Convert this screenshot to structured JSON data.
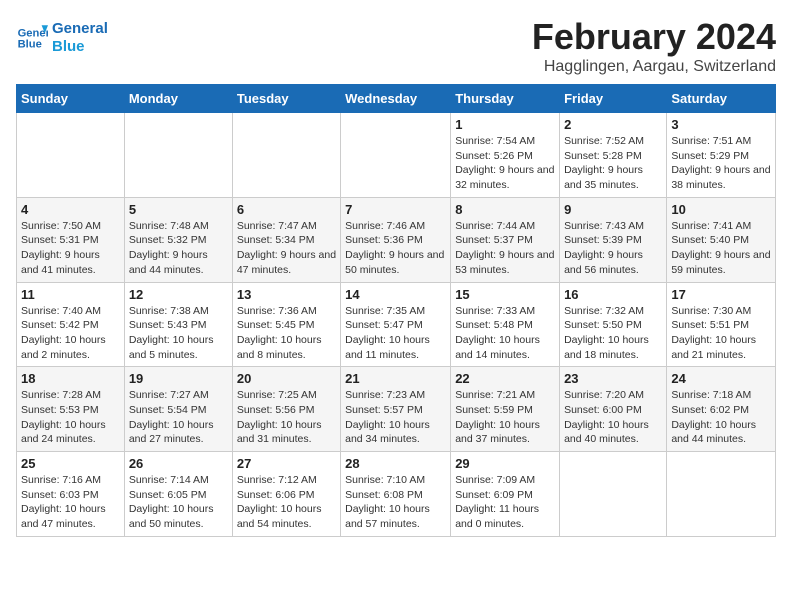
{
  "header": {
    "logo_general": "General",
    "logo_blue": "Blue",
    "month": "February 2024",
    "location": "Hagglingen, Aargau, Switzerland"
  },
  "days_of_week": [
    "Sunday",
    "Monday",
    "Tuesday",
    "Wednesday",
    "Thursday",
    "Friday",
    "Saturday"
  ],
  "weeks": [
    [
      {
        "day": "",
        "info": ""
      },
      {
        "day": "",
        "info": ""
      },
      {
        "day": "",
        "info": ""
      },
      {
        "day": "",
        "info": ""
      },
      {
        "day": "1",
        "info": "Sunrise: 7:54 AM\nSunset: 5:26 PM\nDaylight: 9 hours and 32 minutes."
      },
      {
        "day": "2",
        "info": "Sunrise: 7:52 AM\nSunset: 5:28 PM\nDaylight: 9 hours and 35 minutes."
      },
      {
        "day": "3",
        "info": "Sunrise: 7:51 AM\nSunset: 5:29 PM\nDaylight: 9 hours and 38 minutes."
      }
    ],
    [
      {
        "day": "4",
        "info": "Sunrise: 7:50 AM\nSunset: 5:31 PM\nDaylight: 9 hours and 41 minutes."
      },
      {
        "day": "5",
        "info": "Sunrise: 7:48 AM\nSunset: 5:32 PM\nDaylight: 9 hours and 44 minutes."
      },
      {
        "day": "6",
        "info": "Sunrise: 7:47 AM\nSunset: 5:34 PM\nDaylight: 9 hours and 47 minutes."
      },
      {
        "day": "7",
        "info": "Sunrise: 7:46 AM\nSunset: 5:36 PM\nDaylight: 9 hours and 50 minutes."
      },
      {
        "day": "8",
        "info": "Sunrise: 7:44 AM\nSunset: 5:37 PM\nDaylight: 9 hours and 53 minutes."
      },
      {
        "day": "9",
        "info": "Sunrise: 7:43 AM\nSunset: 5:39 PM\nDaylight: 9 hours and 56 minutes."
      },
      {
        "day": "10",
        "info": "Sunrise: 7:41 AM\nSunset: 5:40 PM\nDaylight: 9 hours and 59 minutes."
      }
    ],
    [
      {
        "day": "11",
        "info": "Sunrise: 7:40 AM\nSunset: 5:42 PM\nDaylight: 10 hours and 2 minutes."
      },
      {
        "day": "12",
        "info": "Sunrise: 7:38 AM\nSunset: 5:43 PM\nDaylight: 10 hours and 5 minutes."
      },
      {
        "day": "13",
        "info": "Sunrise: 7:36 AM\nSunset: 5:45 PM\nDaylight: 10 hours and 8 minutes."
      },
      {
        "day": "14",
        "info": "Sunrise: 7:35 AM\nSunset: 5:47 PM\nDaylight: 10 hours and 11 minutes."
      },
      {
        "day": "15",
        "info": "Sunrise: 7:33 AM\nSunset: 5:48 PM\nDaylight: 10 hours and 14 minutes."
      },
      {
        "day": "16",
        "info": "Sunrise: 7:32 AM\nSunset: 5:50 PM\nDaylight: 10 hours and 18 minutes."
      },
      {
        "day": "17",
        "info": "Sunrise: 7:30 AM\nSunset: 5:51 PM\nDaylight: 10 hours and 21 minutes."
      }
    ],
    [
      {
        "day": "18",
        "info": "Sunrise: 7:28 AM\nSunset: 5:53 PM\nDaylight: 10 hours and 24 minutes."
      },
      {
        "day": "19",
        "info": "Sunrise: 7:27 AM\nSunset: 5:54 PM\nDaylight: 10 hours and 27 minutes."
      },
      {
        "day": "20",
        "info": "Sunrise: 7:25 AM\nSunset: 5:56 PM\nDaylight: 10 hours and 31 minutes."
      },
      {
        "day": "21",
        "info": "Sunrise: 7:23 AM\nSunset: 5:57 PM\nDaylight: 10 hours and 34 minutes."
      },
      {
        "day": "22",
        "info": "Sunrise: 7:21 AM\nSunset: 5:59 PM\nDaylight: 10 hours and 37 minutes."
      },
      {
        "day": "23",
        "info": "Sunrise: 7:20 AM\nSunset: 6:00 PM\nDaylight: 10 hours and 40 minutes."
      },
      {
        "day": "24",
        "info": "Sunrise: 7:18 AM\nSunset: 6:02 PM\nDaylight: 10 hours and 44 minutes."
      }
    ],
    [
      {
        "day": "25",
        "info": "Sunrise: 7:16 AM\nSunset: 6:03 PM\nDaylight: 10 hours and 47 minutes."
      },
      {
        "day": "26",
        "info": "Sunrise: 7:14 AM\nSunset: 6:05 PM\nDaylight: 10 hours and 50 minutes."
      },
      {
        "day": "27",
        "info": "Sunrise: 7:12 AM\nSunset: 6:06 PM\nDaylight: 10 hours and 54 minutes."
      },
      {
        "day": "28",
        "info": "Sunrise: 7:10 AM\nSunset: 6:08 PM\nDaylight: 10 hours and 57 minutes."
      },
      {
        "day": "29",
        "info": "Sunrise: 7:09 AM\nSunset: 6:09 PM\nDaylight: 11 hours and 0 minutes."
      },
      {
        "day": "",
        "info": ""
      },
      {
        "day": "",
        "info": ""
      }
    ]
  ]
}
